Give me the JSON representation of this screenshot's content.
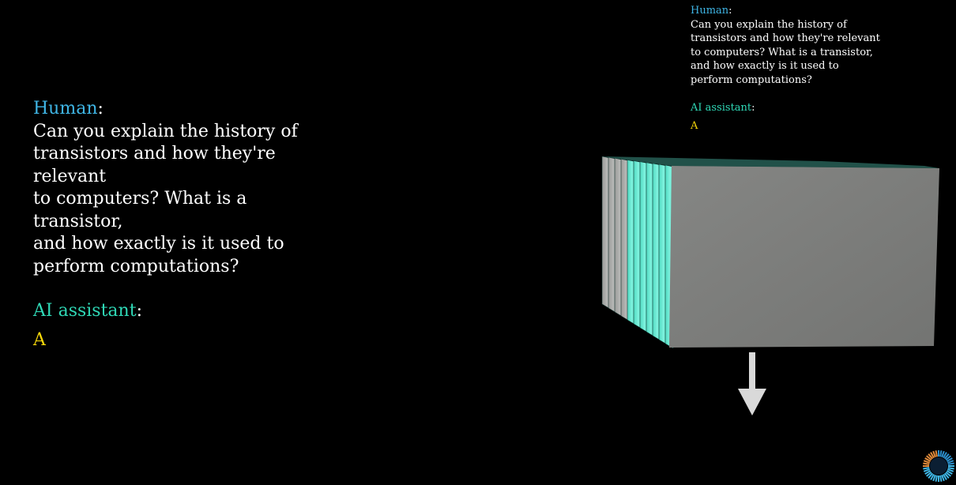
{
  "large_dialogue": {
    "human_label": "Human",
    "colon": ":",
    "prompt": "Can you explain the history of\ntransistors and how they're relevant\nto computers? What is a transistor,\nand how exactly is it used to\nperform computations?",
    "ai_label": "AI assistant",
    "answer": "A"
  },
  "small_dialogue": {
    "human_label": "Human",
    "colon": ":",
    "prompt": "Can you explain the history of\ntransistors and how they're relevant\nto computers? What is a transistor,\nand how exactly is it used to\nperform computations?",
    "ai_label": "AI assistant",
    "answer": "A"
  },
  "colors": {
    "background": "#000000",
    "human": "#3fb6e6",
    "ai": "#2fd8b6",
    "answer": "#f5d60a",
    "layer_gray": "#7c7d7b",
    "layer_teal": "#5ee8d0",
    "arrow": "#d9d9d9"
  },
  "icons": {
    "arrow": "down-arrow-icon",
    "loader": "loading-spinner-icon"
  }
}
